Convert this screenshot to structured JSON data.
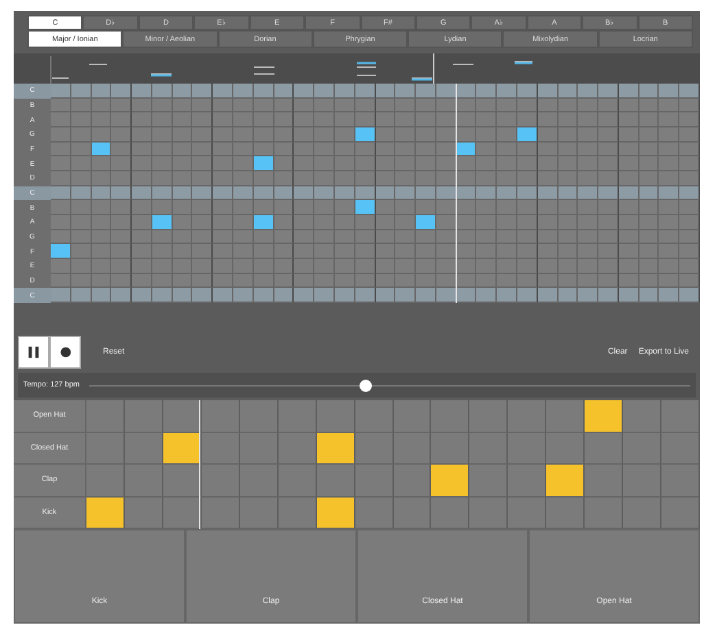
{
  "keys": [
    {
      "label": "C",
      "selected": true
    },
    {
      "label": "D♭",
      "selected": false
    },
    {
      "label": "D",
      "selected": false
    },
    {
      "label": "E♭",
      "selected": false
    },
    {
      "label": "E",
      "selected": false
    },
    {
      "label": "F",
      "selected": false
    },
    {
      "label": "F#",
      "selected": false
    },
    {
      "label": "G",
      "selected": false
    },
    {
      "label": "A♭",
      "selected": false
    },
    {
      "label": "A",
      "selected": false
    },
    {
      "label": "B♭",
      "selected": false
    },
    {
      "label": "B",
      "selected": false
    }
  ],
  "scales": [
    {
      "label": "Major / Ionian",
      "selected": true
    },
    {
      "label": "Minor / Aeolian",
      "selected": false
    },
    {
      "label": "Dorian",
      "selected": false
    },
    {
      "label": "Phrygian",
      "selected": false
    },
    {
      "label": "Lydian",
      "selected": false
    },
    {
      "label": "Mixolydian",
      "selected": false
    },
    {
      "label": "Locrian",
      "selected": false
    }
  ],
  "piano_roll": {
    "playhead": [
      false,
      false,
      false,
      false,
      false,
      false,
      false,
      false,
      false,
      false,
      false,
      false,
      false,
      false,
      false,
      false,
      false,
      false,
      false,
      true,
      false,
      false,
      false,
      false,
      false,
      false,
      false,
      false,
      false,
      false,
      false,
      false
    ],
    "rows": [
      {
        "label": "C",
        "root": true,
        "steps": [
          false,
          false,
          false,
          false,
          false,
          false,
          false,
          false,
          false,
          false,
          false,
          false,
          false,
          false,
          false,
          false,
          false,
          false,
          false,
          false,
          false,
          false,
          false,
          false,
          false,
          false,
          false,
          false,
          false,
          false,
          false,
          false
        ]
      },
      {
        "label": "B",
        "root": false,
        "steps": [
          false,
          false,
          false,
          false,
          false,
          false,
          false,
          false,
          false,
          false,
          false,
          false,
          false,
          false,
          false,
          false,
          false,
          false,
          false,
          false,
          false,
          false,
          false,
          false,
          false,
          false,
          false,
          false,
          false,
          false,
          false,
          false
        ]
      },
      {
        "label": "A",
        "root": false,
        "steps": [
          false,
          false,
          false,
          false,
          false,
          false,
          false,
          false,
          false,
          false,
          false,
          false,
          false,
          false,
          false,
          false,
          false,
          false,
          false,
          false,
          false,
          false,
          false,
          false,
          false,
          false,
          false,
          false,
          false,
          false,
          false,
          false
        ]
      },
      {
        "label": "G",
        "root": false,
        "steps": [
          false,
          false,
          false,
          false,
          false,
          false,
          false,
          false,
          false,
          false,
          false,
          false,
          false,
          false,
          false,
          true,
          false,
          false,
          false,
          false,
          false,
          false,
          false,
          true,
          false,
          false,
          false,
          false,
          false,
          false,
          false,
          false
        ]
      },
      {
        "label": "F",
        "root": false,
        "steps": [
          false,
          false,
          true,
          false,
          false,
          false,
          false,
          false,
          false,
          false,
          false,
          false,
          false,
          false,
          false,
          false,
          false,
          false,
          false,
          false,
          true,
          false,
          false,
          false,
          false,
          false,
          false,
          false,
          false,
          false,
          false,
          false
        ]
      },
      {
        "label": "E",
        "root": false,
        "steps": [
          false,
          false,
          false,
          false,
          false,
          false,
          false,
          false,
          false,
          false,
          true,
          false,
          false,
          false,
          false,
          false,
          false,
          false,
          false,
          false,
          false,
          false,
          false,
          false,
          false,
          false,
          false,
          false,
          false,
          false,
          false,
          false
        ]
      },
      {
        "label": "D",
        "root": false,
        "steps": [
          false,
          false,
          false,
          false,
          false,
          false,
          false,
          false,
          false,
          false,
          false,
          false,
          false,
          false,
          false,
          false,
          false,
          false,
          false,
          false,
          false,
          false,
          false,
          false,
          false,
          false,
          false,
          false,
          false,
          false,
          false,
          false
        ]
      },
      {
        "label": "C",
        "root": true,
        "steps": [
          false,
          false,
          false,
          false,
          false,
          false,
          false,
          false,
          false,
          false,
          false,
          false,
          false,
          false,
          false,
          false,
          false,
          false,
          false,
          false,
          false,
          false,
          false,
          false,
          false,
          false,
          false,
          false,
          false,
          false,
          false,
          false
        ]
      },
      {
        "label": "B",
        "root": false,
        "steps": [
          false,
          false,
          false,
          false,
          false,
          false,
          false,
          false,
          false,
          false,
          false,
          false,
          false,
          false,
          false,
          true,
          false,
          false,
          false,
          false,
          false,
          false,
          false,
          false,
          false,
          false,
          false,
          false,
          false,
          false,
          false,
          false
        ]
      },
      {
        "label": "A",
        "root": false,
        "steps": [
          false,
          false,
          false,
          false,
          false,
          true,
          false,
          false,
          false,
          false,
          true,
          false,
          false,
          false,
          false,
          false,
          false,
          false,
          true,
          false,
          false,
          false,
          false,
          false,
          false,
          false,
          false,
          false,
          false,
          false,
          false,
          false
        ]
      },
      {
        "label": "G",
        "root": false,
        "steps": [
          false,
          false,
          false,
          false,
          false,
          false,
          false,
          false,
          false,
          false,
          false,
          false,
          false,
          false,
          false,
          false,
          false,
          false,
          false,
          false,
          false,
          false,
          false,
          false,
          false,
          false,
          false,
          false,
          false,
          false,
          false,
          false
        ]
      },
      {
        "label": "F",
        "root": false,
        "steps": [
          true,
          false,
          false,
          false,
          false,
          false,
          false,
          false,
          false,
          false,
          false,
          false,
          false,
          false,
          false,
          false,
          false,
          false,
          false,
          false,
          false,
          false,
          false,
          false,
          false,
          false,
          false,
          false,
          false,
          false,
          false,
          false
        ]
      },
      {
        "label": "E",
        "root": false,
        "steps": [
          false,
          false,
          false,
          false,
          false,
          false,
          false,
          false,
          false,
          false,
          false,
          false,
          false,
          false,
          false,
          false,
          false,
          false,
          false,
          false,
          false,
          false,
          false,
          false,
          false,
          false,
          false,
          false,
          false,
          false,
          false,
          false
        ]
      },
      {
        "label": "D",
        "root": false,
        "steps": [
          false,
          false,
          false,
          false,
          false,
          false,
          false,
          false,
          false,
          false,
          false,
          false,
          false,
          false,
          false,
          false,
          false,
          false,
          false,
          false,
          false,
          false,
          false,
          false,
          false,
          false,
          false,
          false,
          false,
          false,
          false,
          false
        ]
      },
      {
        "label": "C",
        "root": true,
        "steps": [
          false,
          false,
          false,
          false,
          false,
          false,
          false,
          false,
          false,
          false,
          false,
          false,
          false,
          false,
          false,
          false,
          false,
          false,
          false,
          false,
          false,
          false,
          false,
          false,
          false,
          false,
          false,
          false,
          false,
          false,
          false,
          false
        ]
      }
    ]
  },
  "transport": {
    "buttons": [
      {
        "kind": "pause"
      },
      {
        "kind": "record"
      }
    ],
    "reset": "Reset",
    "clear": "Clear",
    "export": "Export to Live"
  },
  "tempo": {
    "label": "Tempo: 127 bpm",
    "level": 0.46
  },
  "drums": {
    "playhead": [
      false,
      false,
      true,
      false,
      false,
      false,
      false,
      false,
      false,
      false,
      false,
      false,
      false,
      false,
      false,
      false
    ],
    "rows": [
      {
        "label": "Open Hat",
        "steps": [
          false,
          false,
          false,
          false,
          false,
          false,
          false,
          false,
          false,
          false,
          false,
          false,
          false,
          true,
          false,
          false
        ]
      },
      {
        "label": "Closed Hat",
        "steps": [
          false,
          false,
          true,
          false,
          false,
          false,
          true,
          false,
          false,
          false,
          false,
          false,
          false,
          false,
          false,
          false
        ]
      },
      {
        "label": "Clap",
        "steps": [
          false,
          false,
          false,
          false,
          false,
          false,
          false,
          false,
          false,
          true,
          false,
          false,
          true,
          false,
          false,
          false
        ]
      },
      {
        "label": "Kick",
        "steps": [
          true,
          false,
          false,
          false,
          false,
          false,
          true,
          false,
          false,
          false,
          false,
          false,
          false,
          false,
          false,
          false
        ]
      }
    ]
  },
  "pads": [
    "Kick",
    "Clap",
    "Closed Hat",
    "Open Hat"
  ]
}
